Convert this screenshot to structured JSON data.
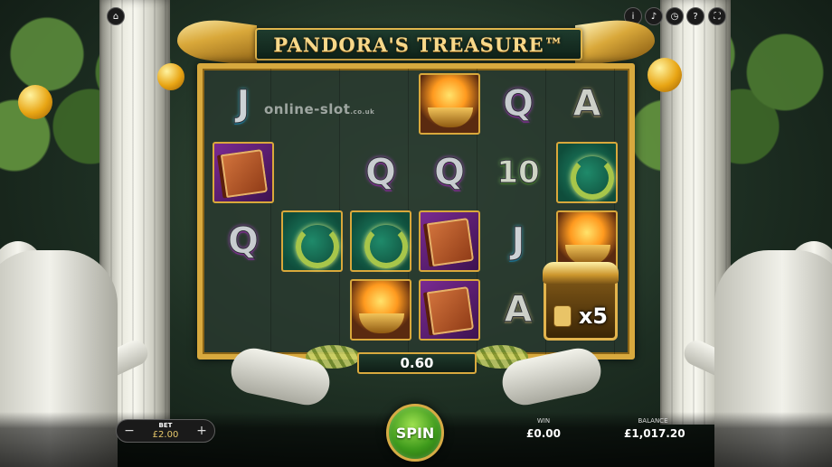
{
  "game": {
    "title": "PANDORA'S TREASURE™",
    "watermark": "online-slot",
    "watermark_suffix": ".co.uk"
  },
  "top_icons": [
    {
      "name": "home-icon",
      "glyph": "⌂"
    },
    {
      "name": "info-icon",
      "glyph": "i"
    },
    {
      "name": "sound-icon",
      "glyph": "♪"
    },
    {
      "name": "history-icon",
      "glyph": "◷"
    },
    {
      "name": "help-icon",
      "glyph": "?"
    },
    {
      "name": "fullscreen-icon",
      "glyph": "⛶"
    }
  ],
  "reels": [
    [
      "J",
      "book",
      "Q",
      "",
      ""
    ],
    [
      "",
      "",
      "wreath",
      "",
      ""
    ],
    [
      "",
      "Q",
      "wreath",
      "fire",
      ""
    ],
    [
      "fire",
      "Q",
      "book",
      "book",
      ""
    ],
    [
      "Q",
      "10",
      "J",
      "A",
      ""
    ],
    [
      "A",
      "wreath",
      "fire",
      "",
      ""
    ]
  ],
  "multiplier": "x5",
  "win_amount": "0.60",
  "bet": {
    "label": "BET",
    "value": "£2.00",
    "minus": "−",
    "plus": "+"
  },
  "spin_label": "SPIN",
  "win": {
    "label": "WIN",
    "value": "£0.00"
  },
  "balance": {
    "label": "BALANCE",
    "value": "£1,017.20"
  },
  "colors": {
    "gold": "#d8a93e",
    "spin_green": "#3e9a1c",
    "frame_bg": "#28382e"
  }
}
